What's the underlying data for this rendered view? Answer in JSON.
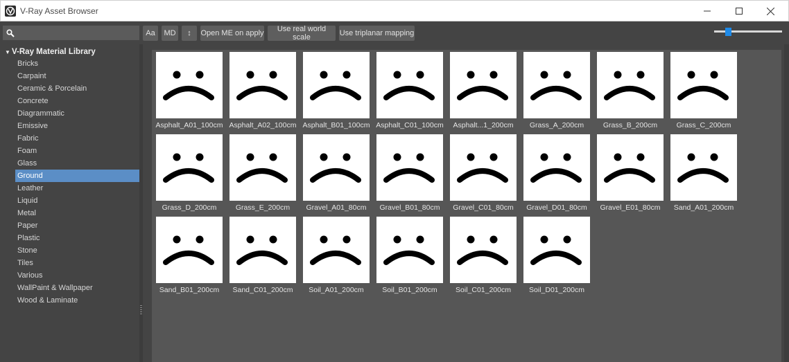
{
  "window": {
    "title": "V-Ray Asset Browser",
    "icons": {
      "app": "vray-logo-icon",
      "minimize": "minimize-icon",
      "maximize": "maximize-icon",
      "close": "close-icon"
    }
  },
  "toolbar": {
    "search_value": "",
    "search_icon": "search-icon",
    "btn_case": "Aa",
    "btn_md": "MD",
    "btn_sort": "↕",
    "btn_open_me": "Open ME on apply",
    "btn_real_world": "Use real world scale",
    "btn_triplanar": "Use triplanar mapping",
    "thumbnail_size_fraction": 0.18
  },
  "sidebar": {
    "library_title": "V-Ray Material Library",
    "expand_icon": "triangle-down-icon",
    "items": [
      {
        "label": "Bricks"
      },
      {
        "label": "Carpaint"
      },
      {
        "label": "Ceramic & Porcelain"
      },
      {
        "label": "Concrete"
      },
      {
        "label": "Diagrammatic"
      },
      {
        "label": "Emissive"
      },
      {
        "label": "Fabric"
      },
      {
        "label": "Foam"
      },
      {
        "label": "Glass"
      },
      {
        "label": "Ground"
      },
      {
        "label": "Leather"
      },
      {
        "label": "Liquid"
      },
      {
        "label": "Metal"
      },
      {
        "label": "Paper"
      },
      {
        "label": "Plastic"
      },
      {
        "label": "Stone"
      },
      {
        "label": "Tiles"
      },
      {
        "label": "Various"
      },
      {
        "label": "WallPaint & Wallpaper"
      },
      {
        "label": "Wood & Laminate"
      }
    ],
    "selected": "Ground"
  },
  "assets": {
    "thumbnail_icon": "sad-face-icon",
    "items": [
      "Asphalt_A01_100cm",
      "Asphalt_A02_100cm",
      "Asphalt_B01_100cm",
      "Asphalt_C01_100cm",
      "Asphalt...1_200cm",
      "Grass_A_200cm",
      "Grass_B_200cm",
      "Grass_C_200cm",
      "Grass_D_200cm",
      "Grass_E_200cm",
      "Gravel_A01_80cm",
      "Gravel_B01_80cm",
      "Gravel_C01_80cm",
      "Gravel_D01_80cm",
      "Gravel_E01_80cm",
      "Sand_A01_200cm",
      "Sand_B01_200cm",
      "Sand_C01_200cm",
      "Soil_A01_200cm",
      "Soil_B01_200cm",
      "Soil_C01_200cm",
      "Soil_D01_200cm"
    ]
  },
  "colors": {
    "accent": "#1e8ae8",
    "selection": "#5b8ec6"
  }
}
